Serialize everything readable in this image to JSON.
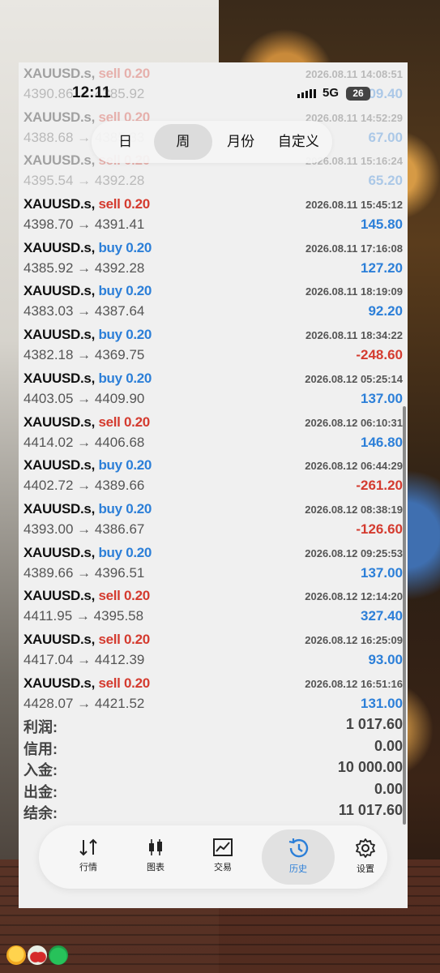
{
  "status_bar": {
    "time": "12:11",
    "network": "5G",
    "battery": "26"
  },
  "period_tabs": [
    {
      "label": "日",
      "active": false
    },
    {
      "label": "周",
      "active": true
    },
    {
      "label": "月份",
      "active": false
    },
    {
      "label": "自定义",
      "active": false
    }
  ],
  "trades": [
    {
      "symbol": "XAUUSD.s,",
      "side": "sell",
      "volume": "0.20",
      "time": "2026.08.11 14:08:51",
      "prices": "4390.86 → 4385.92",
      "profit": "109.40"
    },
    {
      "symbol": "XAUUSD.s,",
      "side": "sell",
      "volume": "0.20",
      "time": "2026.08.11 14:52:29",
      "prices": "4388.68 → 4385.33",
      "profit": "67.00"
    },
    {
      "symbol": "XAUUSD.s,",
      "side": "sell",
      "volume": "0.20",
      "time": "2026.08.11 15:16:24",
      "prices": "4395.54 → 4392.28",
      "profit": "65.20"
    },
    {
      "symbol": "XAUUSD.s,",
      "side": "sell",
      "volume": "0.20",
      "time": "2026.08.11 15:45:12",
      "prices": "4398.70 → 4391.41",
      "profit": "145.80"
    },
    {
      "symbol": "XAUUSD.s,",
      "side": "buy",
      "volume": "0.20",
      "time": "2026.08.11 17:16:08",
      "prices": "4385.92 → 4392.28",
      "profit": "127.20"
    },
    {
      "symbol": "XAUUSD.s,",
      "side": "buy",
      "volume": "0.20",
      "time": "2026.08.11 18:19:09",
      "prices": "4383.03 → 4387.64",
      "profit": "92.20"
    },
    {
      "symbol": "XAUUSD.s,",
      "side": "buy",
      "volume": "0.20",
      "time": "2026.08.11 18:34:22",
      "prices": "4382.18 → 4369.75",
      "profit": "-248.60"
    },
    {
      "symbol": "XAUUSD.s,",
      "side": "buy",
      "volume": "0.20",
      "time": "2026.08.12 05:25:14",
      "prices": "4403.05 → 4409.90",
      "profit": "137.00"
    },
    {
      "symbol": "XAUUSD.s,",
      "side": "sell",
      "volume": "0.20",
      "time": "2026.08.12 06:10:31",
      "prices": "4414.02 → 4406.68",
      "profit": "146.80"
    },
    {
      "symbol": "XAUUSD.s,",
      "side": "buy",
      "volume": "0.20",
      "time": "2026.08.12 06:44:29",
      "prices": "4402.72 → 4389.66",
      "profit": "-261.20"
    },
    {
      "symbol": "XAUUSD.s,",
      "side": "buy",
      "volume": "0.20",
      "time": "2026.08.12 08:38:19",
      "prices": "4393.00 → 4386.67",
      "profit": "-126.60"
    },
    {
      "symbol": "XAUUSD.s,",
      "side": "buy",
      "volume": "0.20",
      "time": "2026.08.12 09:25:53",
      "prices": "4389.66 → 4396.51",
      "profit": "137.00"
    },
    {
      "symbol": "XAUUSD.s,",
      "side": "sell",
      "volume": "0.20",
      "time": "2026.08.12 12:14:20",
      "prices": "4411.95 → 4395.58",
      "profit": "327.40"
    },
    {
      "symbol": "XAUUSD.s,",
      "side": "sell",
      "volume": "0.20",
      "time": "2026.08.12 16:25:09",
      "prices": "4417.04 → 4412.39",
      "profit": "93.00"
    },
    {
      "symbol": "XAUUSD.s,",
      "side": "sell",
      "volume": "0.20",
      "time": "2026.08.12 16:51:16",
      "prices": "4428.07 → 4421.52",
      "profit": "131.00"
    }
  ],
  "summary": [
    {
      "label": "利润:",
      "value": "1 017.60"
    },
    {
      "label": "信用:",
      "value": "0.00"
    },
    {
      "label": "入金:",
      "value": "10 000.00"
    },
    {
      "label": "出金:",
      "value": "0.00"
    },
    {
      "label": "结余:",
      "value": "11 017.60"
    }
  ],
  "nav": [
    {
      "label": "行情",
      "icon": "quotes-arrows-icon",
      "active": false
    },
    {
      "label": "图表",
      "icon": "candlestick-chart-icon",
      "active": false
    },
    {
      "label": "交易",
      "icon": "trade-chart-icon",
      "active": false
    },
    {
      "label": "历史",
      "icon": "history-clock-icon",
      "active": true
    },
    {
      "label": "设置",
      "icon": "gear-icon",
      "active": false
    }
  ],
  "colors": {
    "sell": "#d43b2f",
    "buy": "#2c7fd8",
    "profit_positive": "#2c7fd8",
    "profit_negative": "#d43b2f",
    "active_nav": "#2c7fd8"
  }
}
